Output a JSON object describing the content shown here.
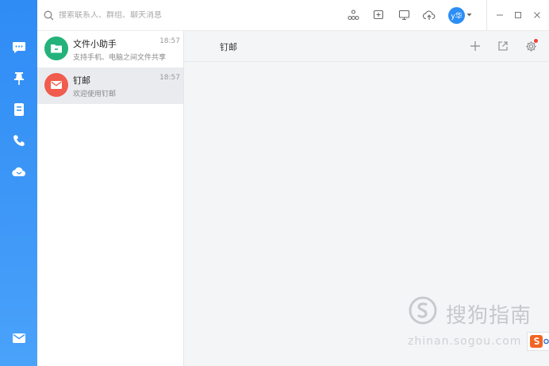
{
  "search": {
    "placeholder": "搜索联系人、群组、聊天消息"
  },
  "profile": {
    "avatar_text": "y华"
  },
  "rail": {
    "items": [
      {
        "name": "messages",
        "icon": "chat-icon"
      },
      {
        "name": "ding",
        "icon": "pin-icon"
      },
      {
        "name": "contacts",
        "icon": "contacts-book-icon"
      },
      {
        "name": "calls",
        "icon": "phone-icon"
      },
      {
        "name": "cloud",
        "icon": "cloud-icon"
      }
    ],
    "bottom": {
      "name": "mail",
      "icon": "mail-icon"
    }
  },
  "toolbar": {
    "icons": [
      "org-structure-icon",
      "add-note-icon",
      "screen-share-icon",
      "cloud-upload-icon"
    ]
  },
  "conversations": [
    {
      "name": "文件小助手",
      "time": "18:57",
      "preview": "支持手机、电脑之间文件共享",
      "avatar_color": "#23b37a",
      "icon": "folder-icon",
      "selected": false
    },
    {
      "name": "钉邮",
      "time": "18:57",
      "preview": "欢迎使用钉邮",
      "avatar_color": "#f05c4d",
      "icon": "mail-icon",
      "selected": true
    }
  ],
  "chat": {
    "title": "钉邮"
  },
  "watermark": {
    "brand": "搜狗指南",
    "url": "zhinan.sogou.com"
  },
  "colors": {
    "rail": "#3d97f7",
    "accent": "#2b8ef5",
    "selected_bg": "#e9ebef",
    "badge_red": "#f04134"
  }
}
